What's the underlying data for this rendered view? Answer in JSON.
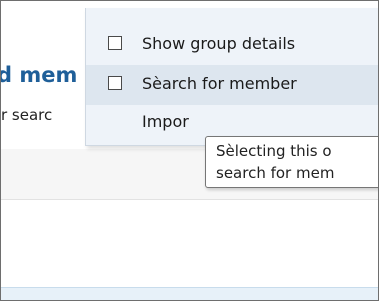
{
  "background": {
    "heading_fragment": "d mem",
    "subtext_fragment": "r searc"
  },
  "menu": {
    "items": [
      {
        "label": "Show group details",
        "checked": false
      },
      {
        "label": "Sèarch for member",
        "checked": false
      },
      {
        "label": "Impor"
      }
    ]
  },
  "tooltip": {
    "line1": "Sèlecting this o",
    "line2": "search for mem"
  },
  "colors": {
    "heading": "#1f5f99",
    "menu_bg": "#eef3f9",
    "menu_hover": "#dde6ef"
  }
}
